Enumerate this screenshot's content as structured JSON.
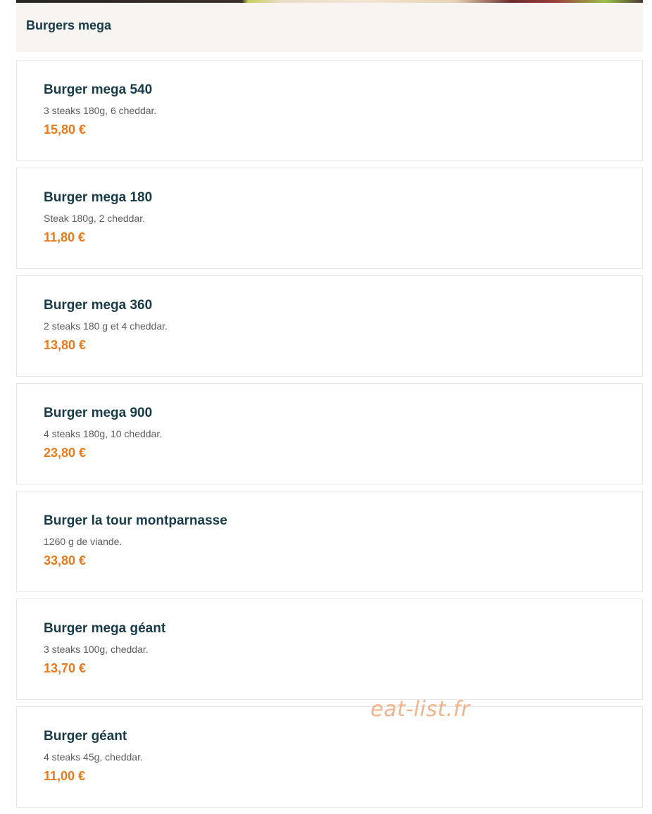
{
  "category": {
    "title": "Burgers mega"
  },
  "items": [
    {
      "name": "Burger mega 540",
      "description": "3 steaks 180g, 6 cheddar.",
      "price": "15,80 €"
    },
    {
      "name": "Burger mega 180",
      "description": "Steak 180g, 2 cheddar.",
      "price": "11,80 €"
    },
    {
      "name": "Burger mega 360",
      "description": "2 steaks 180 g et 4 cheddar.",
      "price": "13,80 €"
    },
    {
      "name": "Burger mega 900",
      "description": "4 steaks 180g, 10 cheddar.",
      "price": "23,80 €"
    },
    {
      "name": "Burger la tour montparnasse",
      "description": "1260 g de viande.",
      "price": "33,80 €"
    },
    {
      "name": "Burger mega géant",
      "description": "3 steaks 100g, cheddar.",
      "price": "13,70 €"
    },
    {
      "name": "Burger géant",
      "description": "4 steaks 45g, cheddar.",
      "price": "11,00 €"
    }
  ],
  "watermark": "eat-list.fr",
  "colors": {
    "heading": "#173b48",
    "price": "#e87a1c",
    "description": "#5b5b5b",
    "header_background": "#f7f4f1",
    "watermark": "#f2b48c"
  }
}
